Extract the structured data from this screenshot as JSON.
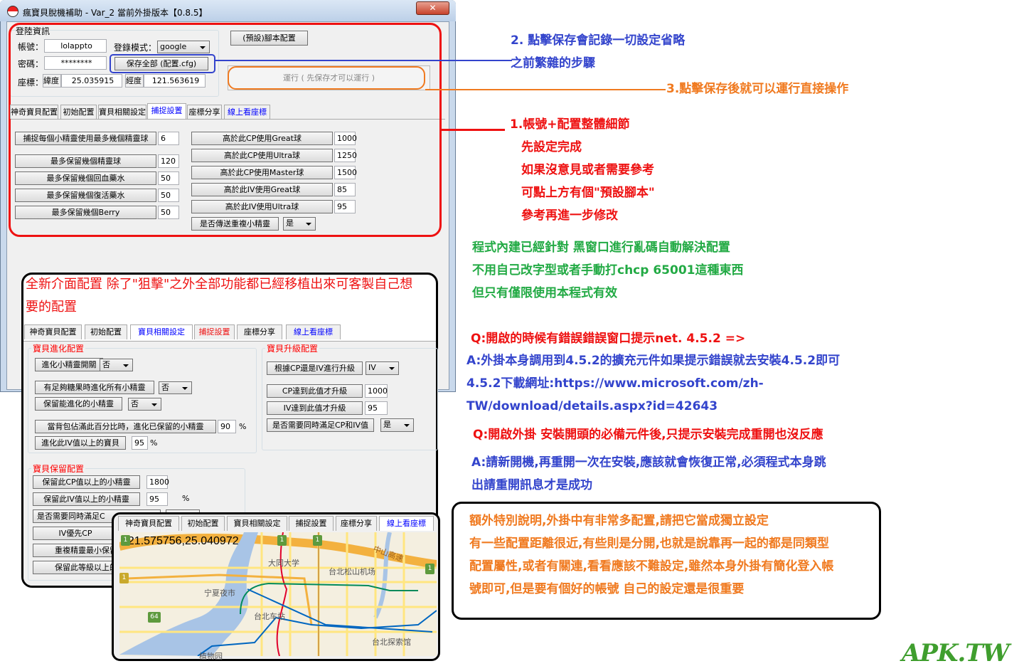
{
  "window": {
    "title": "瘋寶貝脫機補助 - Var_2 當前外掛版本【0.8.5】",
    "close": "✕"
  },
  "login": {
    "group_label": "登陸資訊",
    "account_label": "帳號：",
    "account_value": "lolappto",
    "mode_label": "登錄模式：",
    "mode_value": "google",
    "password_label": "密碼：",
    "password_value": "********",
    "save_button": "保存全部 (配置.cfg)",
    "coord_label": "座標：",
    "lat_label": "緯度",
    "lat_value": "25.035915",
    "lng_label": "經度",
    "lng_value": "121.563619"
  },
  "preset_button": "(預設)腳本配置",
  "run_button": "運行 ( 先保存才可以運行 )",
  "tabs": [
    "神奇寶貝配置",
    "初始配置",
    "寶貝相關設定",
    "捕捉設置",
    "座標分享",
    "線上看座標"
  ],
  "capture": {
    "left": [
      {
        "label": "捕捉每個小精靈使用最多幾個精靈球",
        "value": "6"
      },
      {
        "label": "最多保留幾個精靈球",
        "value": "120"
      },
      {
        "label": "最多保留幾個回血藥水",
        "value": "50"
      },
      {
        "label": "最多保留幾個復活藥水",
        "value": "50"
      },
      {
        "label": "最多保留幾個Berry",
        "value": "50"
      }
    ],
    "right": [
      {
        "label": "高於此CP使用Great球",
        "value": "1000"
      },
      {
        "label": "高於此CP使用Ultra球",
        "value": "1250"
      },
      {
        "label": "高於此CP使用Master球",
        "value": "1500"
      },
      {
        "label": "高於此IV使用Great球",
        "value": "85"
      },
      {
        "label": "高於此IV使用Ultra球",
        "value": "95"
      }
    ],
    "transfer_label": "是否傳送重複小精靈",
    "transfer_value": "是"
  },
  "overlay": {
    "heading1": "全新介面配置 除了\"狙擊\"之外全部功能都已經移植出來可客製自己想",
    "heading2": "要的配置",
    "evolve": {
      "title": "寶貝進化配置",
      "switch_label": "進化小精靈開關",
      "switch_value": "否",
      "all_label": "有足夠糖果時進化所有小精靈",
      "all_value": "否",
      "keep_label": "保留能進化的小精靈",
      "keep_value": "否",
      "bag_label": "當背包佔滿此百分比時，進化已保留的小精靈",
      "bag_value": "90",
      "iv_label": "進化此IV值以上的寶貝",
      "iv_value": "95",
      "pct": "%"
    },
    "upgrade": {
      "title": "寶貝升級配置",
      "basis_label": "根據CP還是IV進行升級",
      "basis_value": "IV",
      "cp_label": "CP達到此值才升級",
      "cp_value": "1000",
      "iv_label": "IV達到此值才升級",
      "iv_value": "95",
      "both_label": "是否需要同時滿足CP和IV值",
      "both_value": "是"
    },
    "keep": {
      "title": "寶貝保留配置",
      "cp_label": "保留此CP值以上的小精靈",
      "cp_value": "1800",
      "iv_label": "保留此IV值以上的小精靈",
      "iv_value": "95",
      "pct": "%",
      "both_label": "是否需要同時滿足C",
      "ivfirst_label": "IV優先CP",
      "dup_label": "重複精靈最小保留",
      "level_label": "保留此等級以上的"
    }
  },
  "map": {
    "coords": "121.575756,25.040972",
    "labels": {
      "datong": "大同大学",
      "songshan": "台北松山机场",
      "ningxia": "宁夏夜市",
      "station": "台北车站",
      "explore": "台北探索馆",
      "highway": "中山高速",
      "botanical": "植物园"
    },
    "shields": [
      "1",
      "1",
      "1",
      "1",
      "1",
      "64"
    ]
  },
  "annotations": {
    "save_note": [
      "2. 點擊保存會記錄一切設定省略",
      "之前繁雜的步驟"
    ],
    "run_note": "3.點擊保存後就可以運行直接操作",
    "account_note": [
      "1.帳號+配置整體細節",
      "先設定完成",
      "如果沒意見或者需要參考",
      "可點上方有個\"預設腳本\"",
      "參考再進一步修改"
    ],
    "green_note": [
      "程式內建已經針對 黑窗口進行亂碼自動解決配置",
      "不用自己改字型或者手動打chcp 65001這種東西",
      "但只有僅限使用本程式有效"
    ],
    "q1": "Q:開啟的時候有錯誤錯誤窗口提示net. 4.5.2 =>",
    "a1": [
      "A:外掛本身調用到4.5.2的擴充元件如果提示錯誤就去安裝4.5.2即可",
      "4.5.2下載網址:https://www.microsoft.com/zh-",
      "TW/download/details.aspx?id=42643"
    ],
    "q2": "Q:開啟外掛 安裝開頭的必備元件後,只提示安裝完成重開也沒反應",
    "a2": [
      "A:請新開機,再重開一次在安裝,應該就會恢復正常,必須程式本身跳",
      "出請重開訊息才是成功"
    ],
    "box": [
      "額外特別說明,外掛中有非常多配置,請把它當成獨立設定",
      "有一些配置距離很近,有些則是分開,也就是說靠再一起的都是同類型",
      "配置屬性,或者有關連,看看應該不難設定,雖然本身外掛有簡化登入帳",
      "號即可,但是要有個好的帳號 自己的設定還是很重要"
    ]
  },
  "watermark": "APK.TW",
  "colors": {
    "red": "#ee1111",
    "blue": "#3344cc",
    "orange": "#f07a20",
    "green": "#22aa44",
    "tab_blue": "#0000ff"
  }
}
